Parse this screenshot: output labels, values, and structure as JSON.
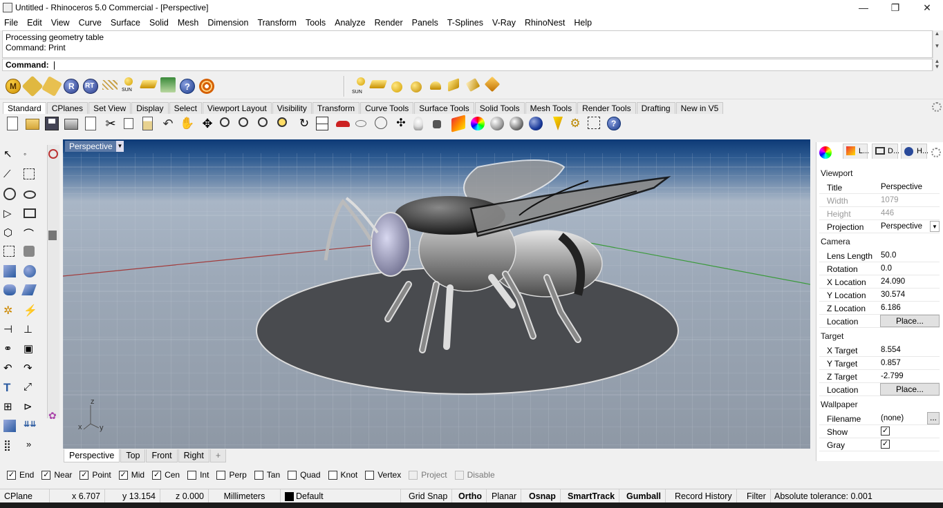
{
  "window": {
    "title": "Untitled - Rhinoceros 5.0 Commercial - [Perspective]",
    "minimize": "—",
    "maximize": "❐",
    "close": "✕"
  },
  "menu": [
    "File",
    "Edit",
    "View",
    "Curve",
    "Surface",
    "Solid",
    "Mesh",
    "Dimension",
    "Transform",
    "Tools",
    "Analyze",
    "Render",
    "Panels",
    "T-Splines",
    "V-Ray",
    "RhinoNest",
    "Help"
  ],
  "command_history": [
    "Processing geometry table",
    "Command: Print"
  ],
  "command_prompt": "Command:",
  "toolbar_tabs": [
    "Standard",
    "CPlanes",
    "Set View",
    "Display",
    "Select",
    "Viewport Layout",
    "Visibility",
    "Transform",
    "Curve Tools",
    "Surface Tools",
    "Solid Tools",
    "Mesh Tools",
    "Render Tools",
    "Drafting",
    "New in V5"
  ],
  "toolbar_icons_row1": [
    "M-icon",
    "material-icon",
    "texture-icon",
    "R-icon",
    "RT-icon",
    "grid-icon",
    "sun-icon",
    "light-icon",
    "tree-icon",
    "help-icon",
    "target-icon"
  ],
  "toolbar_icons_row1_label_sun": "SUN",
  "viewport": {
    "name": "Perspective",
    "axis_x": "x",
    "axis_y": "y",
    "axis_z": "z"
  },
  "viewport_tabs": [
    "Perspective",
    "Top",
    "Front",
    "Right"
  ],
  "viewport_add": "+",
  "panel": {
    "tabs": [
      "L...",
      "D...",
      "H..."
    ],
    "viewport_section": "Viewport",
    "title_label": "Title",
    "title_value": "Perspective",
    "width_label": "Width",
    "width_value": "1079",
    "height_label": "Height",
    "height_value": "446",
    "projection_label": "Projection",
    "projection_value": "Perspective",
    "camera_section": "Camera",
    "lens_label": "Lens Length",
    "lens_value": "50.0",
    "rotation_label": "Rotation",
    "rotation_value": "0.0",
    "xloc_label": "X Location",
    "xloc_value": "24.090",
    "yloc_label": "Y Location",
    "yloc_value": "30.574",
    "zloc_label": "Z Location",
    "zloc_value": "6.186",
    "loc_label": "Location",
    "loc_button": "Place...",
    "target_section": "Target",
    "xt_label": "X Target",
    "xt_value": "8.554",
    "yt_label": "Y Target",
    "yt_value": "0.857",
    "zt_label": "Z Target",
    "zt_value": "-2.799",
    "tloc_label": "Location",
    "tloc_button": "Place...",
    "wallpaper_section": "Wallpaper",
    "filename_label": "Filename",
    "filename_value": "(none)",
    "filename_button": "...",
    "show_label": "Show",
    "gray_label": "Gray"
  },
  "osnaps": [
    {
      "label": "End",
      "checked": true
    },
    {
      "label": "Near",
      "checked": true
    },
    {
      "label": "Point",
      "checked": true
    },
    {
      "label": "Mid",
      "checked": true
    },
    {
      "label": "Cen",
      "checked": true
    },
    {
      "label": "Int",
      "checked": false
    },
    {
      "label": "Perp",
      "checked": false
    },
    {
      "label": "Tan",
      "checked": false
    },
    {
      "label": "Quad",
      "checked": false
    },
    {
      "label": "Knot",
      "checked": false
    },
    {
      "label": "Vertex",
      "checked": false
    },
    {
      "label": "Project",
      "checked": false
    },
    {
      "label": "Disable",
      "checked": false
    }
  ],
  "status": {
    "cplane": "CPlane",
    "x": "x 6.707",
    "y": "y 13.154",
    "z": "z 0.000",
    "units": "Millimeters",
    "layer": "Default",
    "grid_snap": "Grid Snap",
    "ortho": "Ortho",
    "planar": "Planar",
    "osnap": "Osnap",
    "smarttrack": "SmartTrack",
    "gumball": "Gumball",
    "record_history": "Record History",
    "filter": "Filter",
    "tolerance": "Absolute tolerance: 0.001"
  }
}
